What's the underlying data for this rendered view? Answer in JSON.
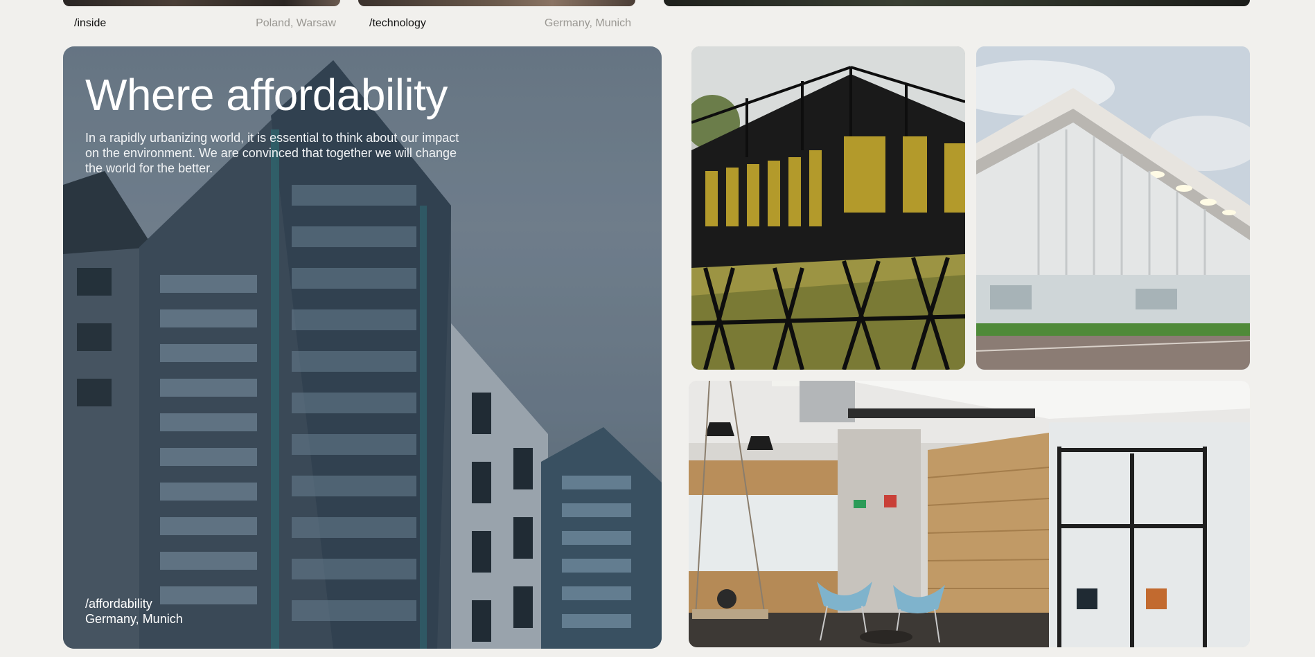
{
  "previous_row": {
    "items": [
      {
        "tag": "/inside",
        "location": "Poland, Warsaw"
      },
      {
        "tag": "/technology",
        "location": "Germany, Munich"
      }
    ]
  },
  "hero": {
    "title": "Where affordability",
    "description": "In a rapidly urbanizing world, it is essential to think about our impact on the environment. We are convinced that together we will change the world for the better.",
    "tag": "/affordability",
    "location": "Germany, Munich"
  },
  "colors": {
    "background": "#f1f0ed",
    "caption_tag": "#111111",
    "caption_location": "#9a9893"
  }
}
